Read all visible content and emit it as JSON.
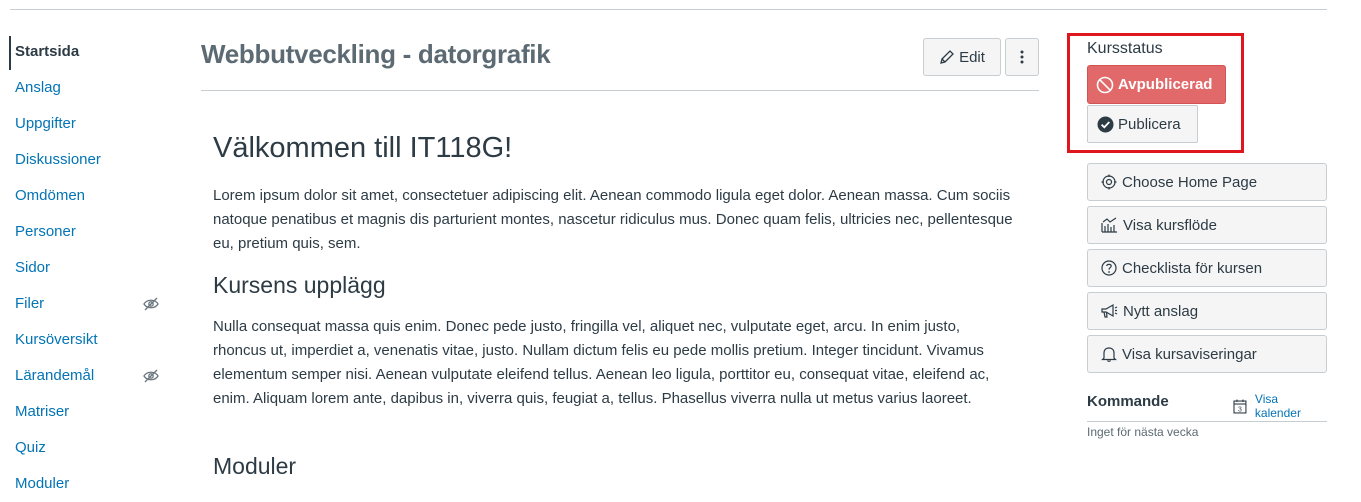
{
  "nav": {
    "items": [
      {
        "label": "Startsida",
        "active": true,
        "hidden": false
      },
      {
        "label": "Anslag",
        "active": false,
        "hidden": false
      },
      {
        "label": "Uppgifter",
        "active": false,
        "hidden": false
      },
      {
        "label": "Diskussioner",
        "active": false,
        "hidden": false
      },
      {
        "label": "Omdömen",
        "active": false,
        "hidden": false
      },
      {
        "label": "Personer",
        "active": false,
        "hidden": false
      },
      {
        "label": "Sidor",
        "active": false,
        "hidden": false
      },
      {
        "label": "Filer",
        "active": false,
        "hidden": true
      },
      {
        "label": "Kursöversikt",
        "active": false,
        "hidden": false
      },
      {
        "label": "Lärandemål",
        "active": false,
        "hidden": true
      },
      {
        "label": "Matriser",
        "active": false,
        "hidden": false
      },
      {
        "label": "Quiz",
        "active": false,
        "hidden": false
      },
      {
        "label": "Moduler",
        "active": false,
        "hidden": false
      }
    ]
  },
  "main": {
    "title": "Webbutveckling - datorgrafik",
    "edit_label": "Edit",
    "welcome_heading": "Välkommen till IT118G!",
    "intro_paragraph": "Lorem ipsum dolor sit amet, consectetuer adipiscing elit. Aenean commodo ligula eget dolor. Aenean massa. Cum sociis natoque penatibus et magnis dis parturient montes, nascetur ridiculus mus. Donec quam felis, ultricies nec, pellentesque eu, pretium quis, sem.",
    "section_heading": "Kursens upplägg",
    "section_paragraph": "Nulla consequat massa quis enim. Donec pede justo, fringilla vel, aliquet nec, vulputate eget, arcu. In enim justo, rhoncus ut, imperdiet a, venenatis vitae, justo. Nullam dictum felis eu pede mollis pretium. Integer tincidunt. Vivamus elementum semper nisi. Aenean vulputate eleifend tellus. Aenean leo ligula, porttitor eu, consequat vitae, eleifend ac, enim. Aliquam lorem ante, dapibus in, viverra quis, feugiat a, tellus. Phasellus viverra nulla ut metus varius laoreet.",
    "modules_heading": "Moduler"
  },
  "aside": {
    "status_label": "Kursstatus",
    "unpublished_label": "Avpublicerad",
    "publish_label": "Publicera",
    "actions": [
      {
        "label": "Choose Home Page",
        "icon": "target-icon"
      },
      {
        "label": "Visa kursflöde",
        "icon": "stream-chart-icon"
      },
      {
        "label": "Checklista för kursen",
        "icon": "question-circle-icon"
      },
      {
        "label": "Nytt anslag",
        "icon": "megaphone-icon"
      },
      {
        "label": "Visa kursaviseringar",
        "icon": "bell-icon"
      }
    ],
    "coming_title": "Kommande",
    "calendar_link": "Visa kalender",
    "calendar_day": "3",
    "coming_empty": "Inget för nästa vecka"
  },
  "colors": {
    "link": "#0374b5",
    "text": "#2d3b45",
    "unpublished": "#e1696a",
    "highlight_box": "#e0161e"
  }
}
